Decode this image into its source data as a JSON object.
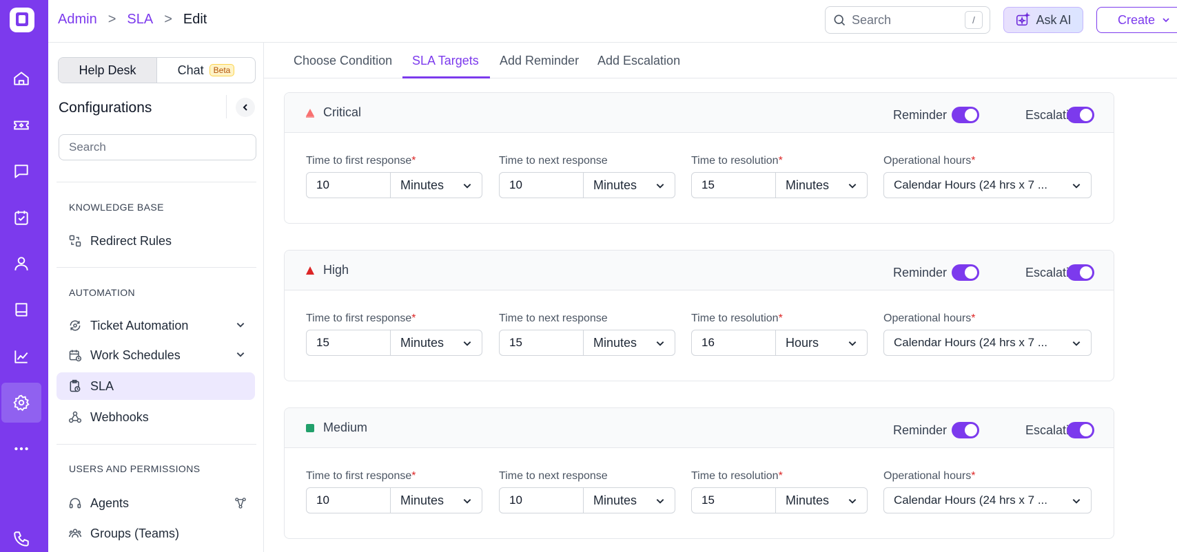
{
  "breadcrumb": {
    "admin": "Admin",
    "sla": "SLA",
    "current": "Edit",
    "sep": ">"
  },
  "search_top": {
    "placeholder": "Search",
    "shortcut": "/"
  },
  "ask_ai": "Ask AI",
  "create": "Create",
  "sidebar": {
    "seg_helpdesk": "Help Desk",
    "seg_chat": "Chat",
    "seg_chat_badge": "Beta",
    "title": "Configurations",
    "search_placeholder": "Search",
    "section_kb": "KNOWLEDGE BASE",
    "redirect_rules": "Redirect Rules",
    "section_automation": "AUTOMATION",
    "ticket_automation": "Ticket Automation",
    "work_schedules": "Work Schedules",
    "sla": "SLA",
    "webhooks": "Webhooks",
    "section_users": "USERS AND PERMISSIONS",
    "agents": "Agents",
    "groups": "Groups (Teams)"
  },
  "tabs": [
    "Choose Condition",
    "SLA Targets",
    "Add Reminder",
    "Add Escalation"
  ],
  "labels": {
    "reminder": "Reminder",
    "escalation": "Escalation",
    "first_response": "Time to first response",
    "next_response": "Time to next response",
    "resolution": "Time to resolution",
    "operational": "Operational hours",
    "required": "*"
  },
  "cards": [
    {
      "priority": "Critical",
      "color": "#f87171",
      "icon": "critical-triangle-icon",
      "first_value": "10",
      "first_unit": "Minutes",
      "next_value": "10",
      "next_unit": "Minutes",
      "resolution_value": "15",
      "resolution_unit": "Minutes",
      "operational": "Calendar Hours (24 hrs x 7 ..."
    },
    {
      "priority": "High",
      "color": "#dc2626",
      "icon": "high-triangle-icon",
      "first_value": "15",
      "first_unit": "Minutes",
      "next_value": "15",
      "next_unit": "Minutes",
      "resolution_value": "16",
      "resolution_unit": "Hours",
      "operational": "Calendar Hours (24 hrs x 7 ..."
    },
    {
      "priority": "Medium",
      "color": "#22a06b",
      "icon": "medium-square-icon",
      "first_value": "10",
      "first_unit": "Minutes",
      "next_value": "10",
      "next_unit": "Minutes",
      "resolution_value": "15",
      "resolution_unit": "Minutes",
      "operational": "Calendar Hours (24 hrs x 7 ..."
    }
  ],
  "colors": {
    "accent": "#7c3aed"
  }
}
